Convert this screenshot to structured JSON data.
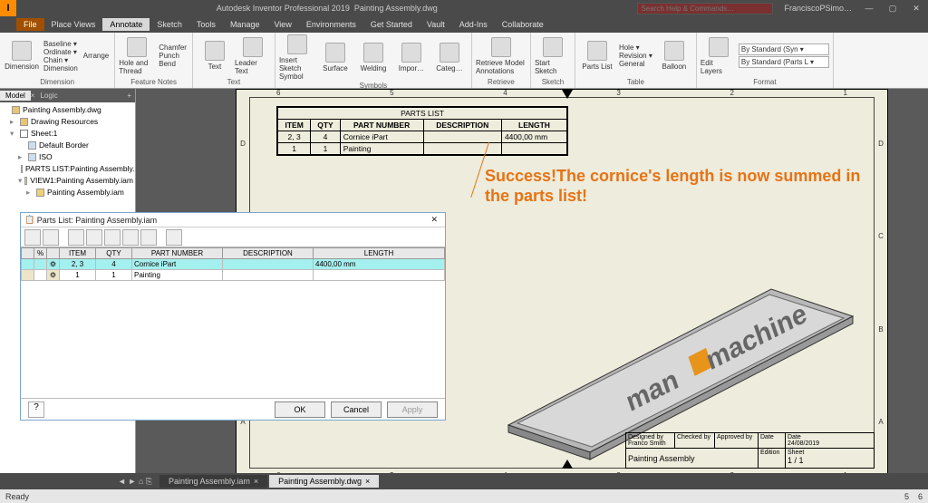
{
  "titlebar": {
    "app_name": "Autodesk Inventor Professional 2019",
    "doc_name": "Painting Assembly.dwg",
    "search_placeholder": "Search Help & Commands…",
    "user": "FranciscoPSimo…"
  },
  "menu_tabs": [
    "File",
    "Place Views",
    "Annotate",
    "Sketch",
    "Tools",
    "Manage",
    "View",
    "Environments",
    "Get Started",
    "Vault",
    "Add-Ins",
    "Collaborate"
  ],
  "ribbon": {
    "dimension": {
      "btn": "Dimension",
      "items": [
        "Baseline ▾",
        "Ordinate ▾",
        "Chain ▾",
        "Dimension"
      ],
      "extras": [
        "Arrange"
      ],
      "label": "Dimension"
    },
    "feature_notes": {
      "btn1": "Hole and Thread",
      "btn2": "Bend",
      "items": [
        "Chamfer",
        "Punch"
      ],
      "label": "Feature Notes"
    },
    "text": {
      "btn1": "Text",
      "btn2": "Leader Text",
      "label": "Text"
    },
    "sketch": {
      "btn": "Insert Sketch Symbol",
      "label": "Symbols",
      "others": [
        "Surface",
        "Welding",
        "Impor…",
        "Categ…"
      ]
    },
    "retrieve": {
      "btn1": "Retrieve Model Annotations",
      "label": "Retrieve"
    },
    "sketch2": {
      "btn": "Start Sketch",
      "label": "Sketch"
    },
    "table": {
      "btn": "Parts List",
      "items": [
        "Hole ▾",
        "Revision ▾",
        "General"
      ],
      "label": "Table"
    },
    "balloon": {
      "btn": "Balloon"
    },
    "layers": {
      "btn": "Edit Layers",
      "label": "Format",
      "combos": [
        "By Standard (Syn ▾",
        "By Standard (Parts L ▾"
      ]
    }
  },
  "browser": {
    "tabs": [
      "Model",
      "Logic"
    ],
    "root": "Painting Assembly.dwg",
    "items": [
      "Drawing Resources",
      "Sheet:1",
      "Default Border",
      "ISO",
      "PARTS LIST:Painting Assembly.iam",
      "VIEW1:Painting Assembly.iam",
      "Painting Assembly.iam"
    ]
  },
  "drawing": {
    "parts_list_title": "PARTS LIST",
    "headers": [
      "ITEM",
      "QTY",
      "PART NUMBER",
      "DESCRIPTION",
      "LENGTH"
    ],
    "rows": [
      [
        "2, 3",
        "4",
        "Cornice iPart",
        "",
        "4400,00 mm"
      ],
      [
        "1",
        "1",
        "Painting",
        "",
        ""
      ]
    ],
    "ruler_h": [
      "6",
      "5",
      "4",
      "3",
      "2",
      "1"
    ],
    "ruler_v": [
      "D",
      "C",
      "B",
      "A"
    ],
    "annotation": "Success!The cornice's length is now summed in the parts list!",
    "logo_text_1": "man",
    "logo_text_2": "machine"
  },
  "titleblock": {
    "designed_by_lbl": "Designed by",
    "designed_by": "Franco Smith",
    "checked_by_lbl": "Checked by",
    "approved_by_lbl": "Approved by",
    "date_lbl": "Date",
    "date": "24/08/2019",
    "title": "Painting Assembly",
    "edition_lbl": "Edition",
    "sheet_lbl": "Sheet",
    "sheet": "1 / 1"
  },
  "dialog": {
    "title": "Parts List: Painting Assembly.iam",
    "headers": [
      "",
      "%",
      "",
      "ITEM",
      "QTY",
      "PART NUMBER",
      "DESCRIPTION",
      "LENGTH"
    ],
    "rows": [
      [
        "",
        "",
        "",
        "2, 3",
        "4",
        "Cornice iPart",
        "",
        "4400,00 mm"
      ],
      [
        "",
        "",
        "",
        "1",
        "1",
        "Painting",
        "",
        ""
      ]
    ],
    "ok": "OK",
    "cancel": "Cancel",
    "apply": "Apply"
  },
  "doc_tabs": [
    {
      "label": "Painting Assembly.iam"
    },
    {
      "label": "Painting Assembly.dwg"
    }
  ],
  "status": {
    "ready": "Ready",
    "page": "5",
    "total": "6"
  }
}
